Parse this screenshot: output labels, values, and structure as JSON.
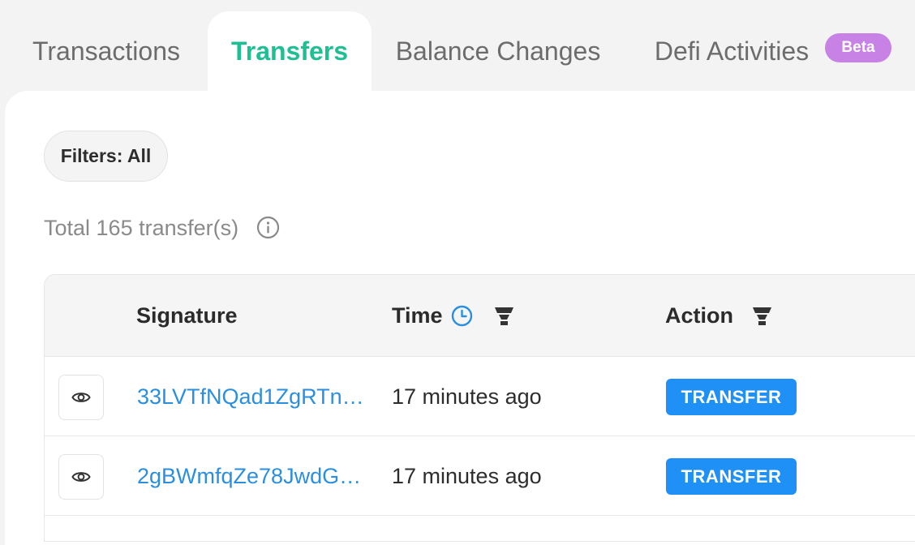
{
  "tabs": [
    {
      "label": "Transactions",
      "active": false
    },
    {
      "label": "Transfers",
      "active": true
    },
    {
      "label": "Balance Changes",
      "active": false
    },
    {
      "label": "Defi Activities",
      "active": false,
      "badge": "Beta"
    }
  ],
  "filter": {
    "label": "Filters: All"
  },
  "summary": {
    "total_text": "Total 165 transfer(s)",
    "info_icon": "info-icon"
  },
  "table": {
    "columns": {
      "signature": "Signature",
      "time": "Time",
      "action": "Action"
    },
    "column_icons": {
      "time": [
        "clock-icon",
        "filter-icon"
      ],
      "action": [
        "filter-icon"
      ]
    },
    "rows": [
      {
        "signature": "33LVTfNQad1ZgRTn…",
        "time": "17 minutes ago",
        "action": "TRANSFER"
      },
      {
        "signature": "2gBWmfqZe78JwdG…",
        "time": "17 minutes ago",
        "action": "TRANSFER"
      }
    ]
  },
  "colors": {
    "active_tab": "#1fbf93",
    "beta_badge": "#c882e6",
    "link": "#2a8fe0",
    "action_badge": "#1f90f5",
    "clock_icon": "#2a8fe0"
  }
}
